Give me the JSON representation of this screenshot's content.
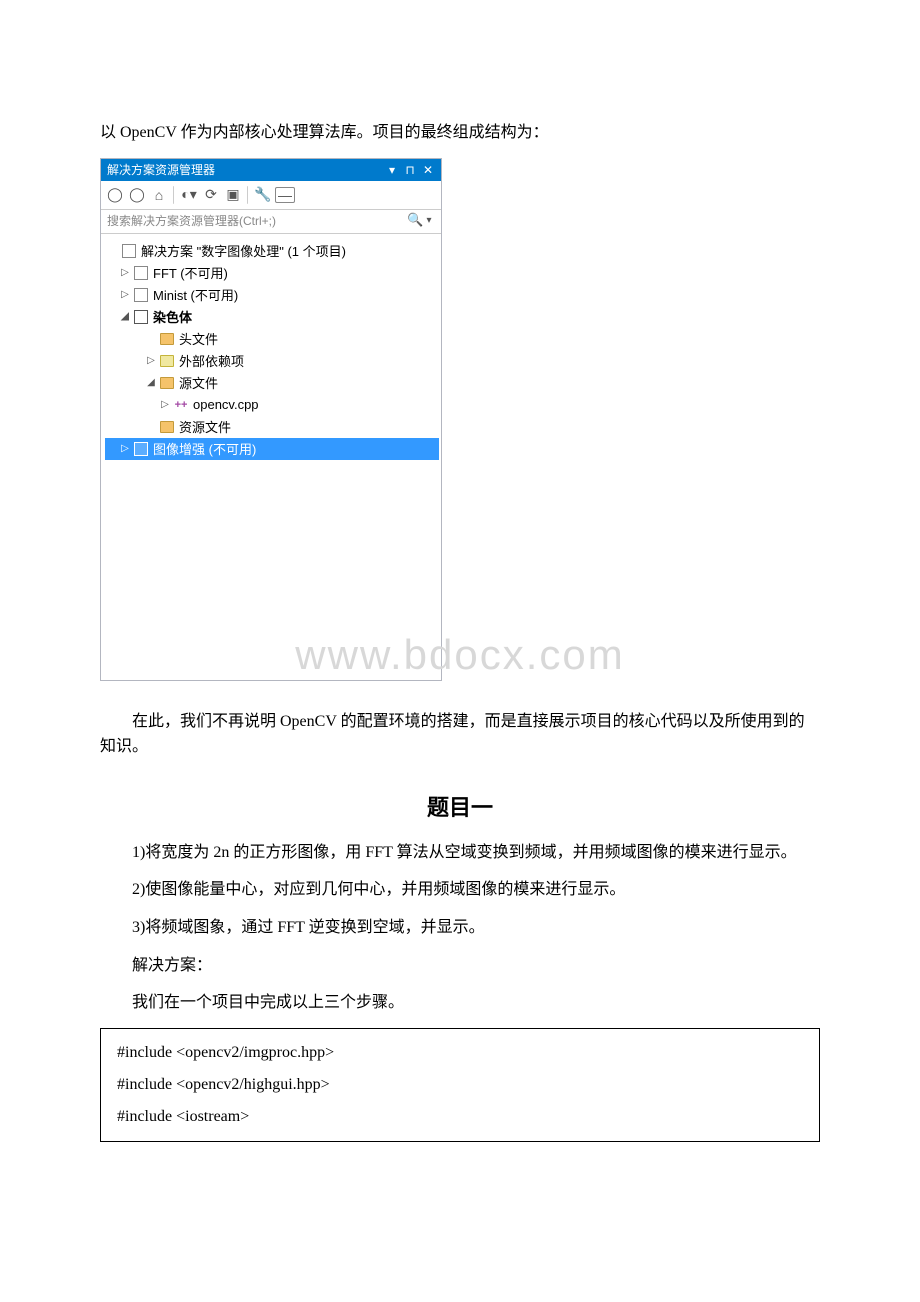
{
  "doc": {
    "intro_line": "以 OpenCV 作为内部核心处理算法库。项目的最终组成结构为：",
    "after_panel": "在此，我们不再说明 OpenCV 的配置环境的搭建，而是直接展示项目的核心代码以及所使用到的知识。",
    "heading": "题目一",
    "p1": "1)将宽度为 2n 的正方形图像，用 FFT 算法从空域变换到频域，并用频域图像的模来进行显示。",
    "p2": "2)使图像能量中心，对应到几何中心，并用频域图像的模来进行显示。",
    "p3": "3)将频域图象，通过 FFT 逆变换到空域，并显示。",
    "p4": "解决方案：",
    "p5": "我们在一个项目中完成以上三个步骤。",
    "code1": "#include <opencv2/imgproc.hpp>",
    "code2": "#include <opencv2/highgui.hpp>",
    "code3": "#include <iostream>"
  },
  "watermark": "www.bdocx.com",
  "panel": {
    "title": "解决方案资源管理器",
    "search_placeholder": "搜索解决方案资源管理器(Ctrl+;)",
    "tree": {
      "solution": "解决方案 \"数字图像处理\" (1 个项目)",
      "fft": "FFT (不可用)",
      "minist": "Minist (不可用)",
      "chrom": "染色体",
      "headers": "头文件",
      "extdeps": "外部依赖项",
      "sources": "源文件",
      "opencv_cpp": "opencv.cpp",
      "resources": "资源文件",
      "enhance": "图像增强 (不可用)"
    }
  }
}
